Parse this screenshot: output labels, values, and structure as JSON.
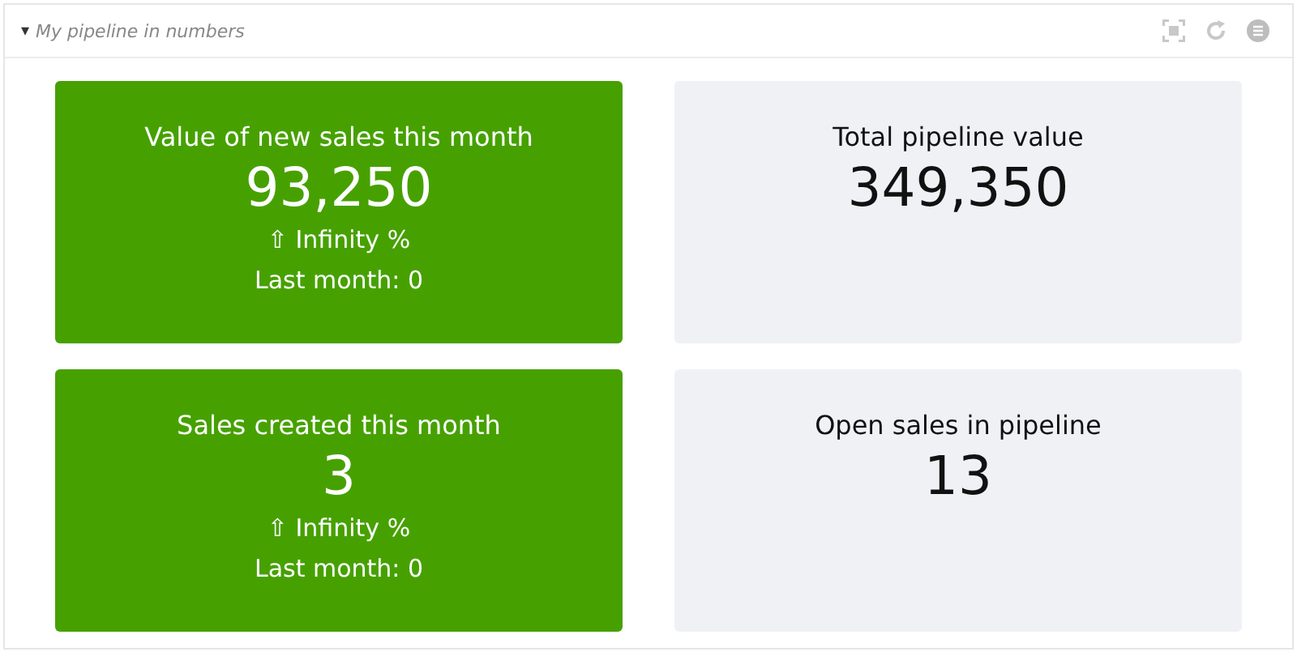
{
  "panel": {
    "toggle": "▾",
    "title": "My pipeline in numbers",
    "expanded": true
  },
  "tiles": [
    {
      "kind": "highlight",
      "label": "Value of new sales this month",
      "value": "93,250",
      "change": "⇧ Infinity %",
      "previous": "Last month: 0"
    },
    {
      "kind": "plain",
      "label": "Total pipeline value",
      "value": "349,350"
    },
    {
      "kind": "highlight",
      "label": "Sales created this month",
      "value": "3",
      "change": "⇧ Infinity %",
      "previous": "Last month: 0"
    },
    {
      "kind": "plain",
      "label": "Open sales in pipeline",
      "value": "13"
    }
  ]
}
